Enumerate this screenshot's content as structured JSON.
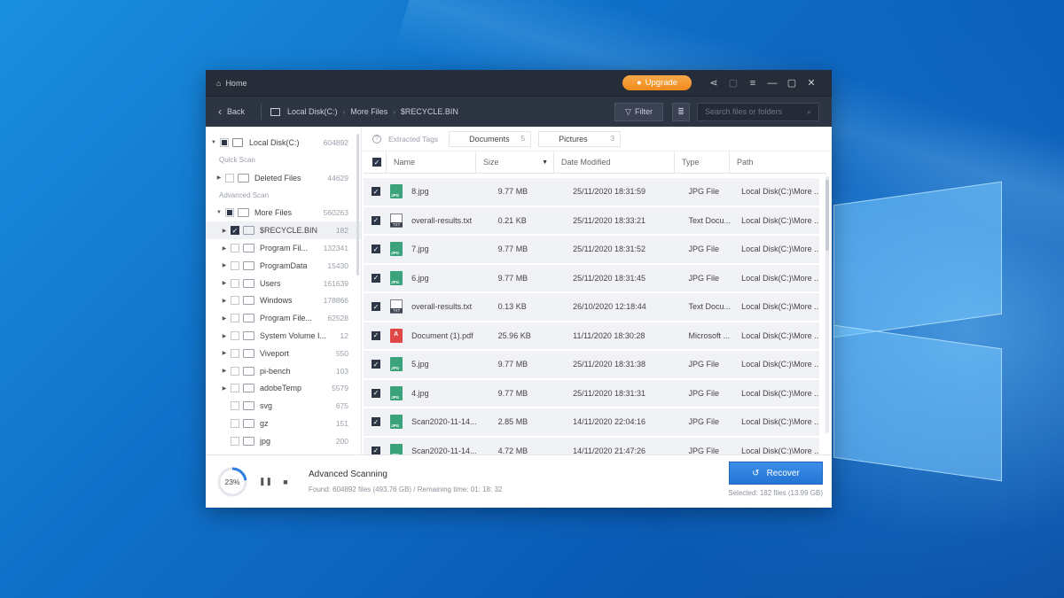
{
  "titlebar": {
    "home_label": "Home",
    "upgrade_label": "Upgrade"
  },
  "navbar": {
    "back_label": "Back",
    "breadcrumbs": [
      "Local Disk(C:)",
      "More Files",
      "$RECYCLE.BIN"
    ],
    "filter_label": "Filter",
    "search_placeholder": "Search files or folders"
  },
  "sidebar": {
    "root": {
      "label": "Local Disk(C:)",
      "count": "604892"
    },
    "quick_scan_label": "Quick Scan",
    "deleted_files": {
      "label": "Deleted Files",
      "count": "44629"
    },
    "advanced_scan_label": "Advanced Scan",
    "more_files": {
      "label": "More Files",
      "count": "560263"
    },
    "folders": [
      {
        "label": "$RECYCLE.BIN",
        "count": "182"
      },
      {
        "label": "Program Fil...",
        "count": "132341"
      },
      {
        "label": "ProgramData",
        "count": "15430"
      },
      {
        "label": "Users",
        "count": "161639"
      },
      {
        "label": "Windows",
        "count": "178866"
      },
      {
        "label": "Program File...",
        "count": "62528"
      },
      {
        "label": "System Volume I...",
        "count": "12"
      },
      {
        "label": "Viveport",
        "count": "550"
      },
      {
        "label": "pi-bench",
        "count": "103"
      },
      {
        "label": "adobeTemp",
        "count": "5579"
      },
      {
        "label": "svg",
        "count": "675"
      },
      {
        "label": "gz",
        "count": "151"
      },
      {
        "label": "jpg",
        "count": "200"
      }
    ]
  },
  "tags": {
    "label": "Extracted Tags",
    "items": [
      {
        "label": "Documents",
        "count": "5"
      },
      {
        "label": "Pictures",
        "count": "3"
      }
    ]
  },
  "table": {
    "columns": [
      "Name",
      "Size",
      "Date Modified",
      "Type",
      "Path"
    ],
    "rows": [
      {
        "icon": "jpg",
        "name": "8.jpg",
        "size": "9.77 MB",
        "date": "25/11/2020 18:31:59",
        "type": "JPG File",
        "path": "Local Disk(C:)\\More ..."
      },
      {
        "icon": "txt",
        "name": "overall-results.txt",
        "size": "0.21 KB",
        "date": "25/11/2020 18:33:21",
        "type": "Text Docu...",
        "path": "Local Disk(C:)\\More ..."
      },
      {
        "icon": "jpg",
        "name": "7.jpg",
        "size": "9.77 MB",
        "date": "25/11/2020 18:31:52",
        "type": "JPG File",
        "path": "Local Disk(C:)\\More ..."
      },
      {
        "icon": "jpg",
        "name": "6.jpg",
        "size": "9.77 MB",
        "date": "25/11/2020 18:31:45",
        "type": "JPG File",
        "path": "Local Disk(C:)\\More ..."
      },
      {
        "icon": "txt",
        "name": "overall-results.txt",
        "size": "0.13 KB",
        "date": "26/10/2020 12:18:44",
        "type": "Text Docu...",
        "path": "Local Disk(C:)\\More ..."
      },
      {
        "icon": "pdf",
        "name": "Document (1).pdf",
        "size": "25.96 KB",
        "date": "11/11/2020 18:30:28",
        "type": "Microsoft ...",
        "path": "Local Disk(C:)\\More ..."
      },
      {
        "icon": "jpg",
        "name": "5.jpg",
        "size": "9.77 MB",
        "date": "25/11/2020 18:31:38",
        "type": "JPG File",
        "path": "Local Disk(C:)\\More ..."
      },
      {
        "icon": "jpg",
        "name": "4.jpg",
        "size": "9.77 MB",
        "date": "25/11/2020 18:31:31",
        "type": "JPG File",
        "path": "Local Disk(C:)\\More ..."
      },
      {
        "icon": "jpg",
        "name": "Scan2020-11-14...",
        "size": "2.85 MB",
        "date": "14/11/2020 22:04:16",
        "type": "JPG File",
        "path": "Local Disk(C:)\\More ..."
      },
      {
        "icon": "jpg",
        "name": "Scan2020-11-14...",
        "size": "4.72 MB",
        "date": "14/11/2020 21:47:26",
        "type": "JPG File",
        "path": "Local Disk(C:)\\More ..."
      }
    ]
  },
  "footer": {
    "progress_label": "23%",
    "progress_fraction": 0.23,
    "scan_title": "Advanced Scanning",
    "scan_status": "Found: 604892 files (493.76 GB) / Remaining time: 01: 18: 32",
    "recover_label": "Recover",
    "selected_info": "Selected: 182 files (13.99 GB)"
  },
  "colors": {
    "accent": "#2e7fe0",
    "upgrade": "#f39a2c",
    "titlebar": "#262c38"
  }
}
